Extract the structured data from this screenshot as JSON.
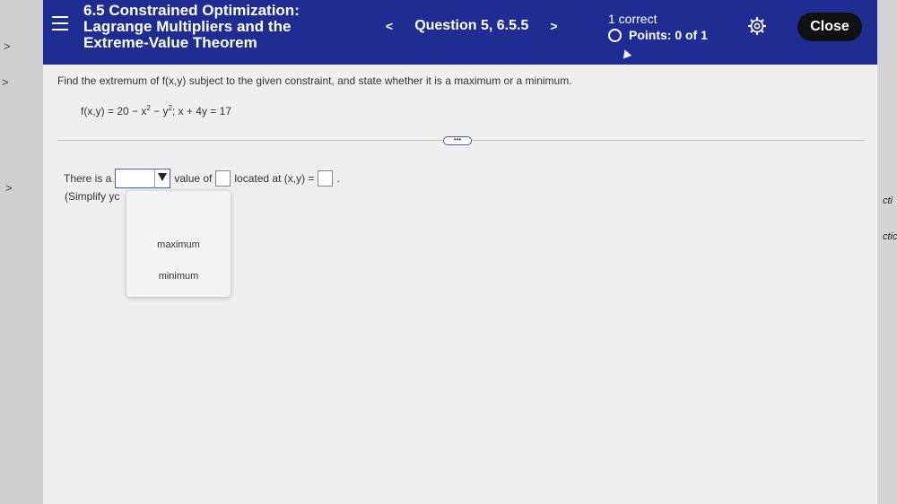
{
  "header": {
    "title_lines": [
      "6.5 Constrained Optimization:",
      "Lagrange Multipliers and the",
      "Extreme-Value Theorem"
    ],
    "question_label": "Question 5, 6.5.5",
    "prev_glyph": "<",
    "next_glyph": ">",
    "correct_text": "1 correct",
    "points_text": "Points: 0 of 1",
    "close_label": "Close"
  },
  "question": {
    "prompt": "Find the extremum of f(x,y) subject to the given constraint, and state whether it is a maximum or a minimum.",
    "formula_parts": {
      "lhs": "f(x,y) = 20 − x",
      "exp1": "2",
      "mid": " − y",
      "exp2": "2",
      "rest": "; x + 4y = 17"
    },
    "expander_text": "•••"
  },
  "answer": {
    "prefix": "There is a",
    "middle": "value of",
    "suffix": "located at (x,y) =",
    "end": ".",
    "simplify_text": "(Simplify yc",
    "dropdown_options": [
      "maximum",
      "minimum"
    ]
  },
  "background": {
    "right_fragments": [
      "cti",
      "ctic"
    ],
    "gutter_glyph": ">"
  },
  "colors": {
    "header_bg": "#1f2d93",
    "close_bg": "#111111",
    "select_border": "#3b62c4"
  }
}
